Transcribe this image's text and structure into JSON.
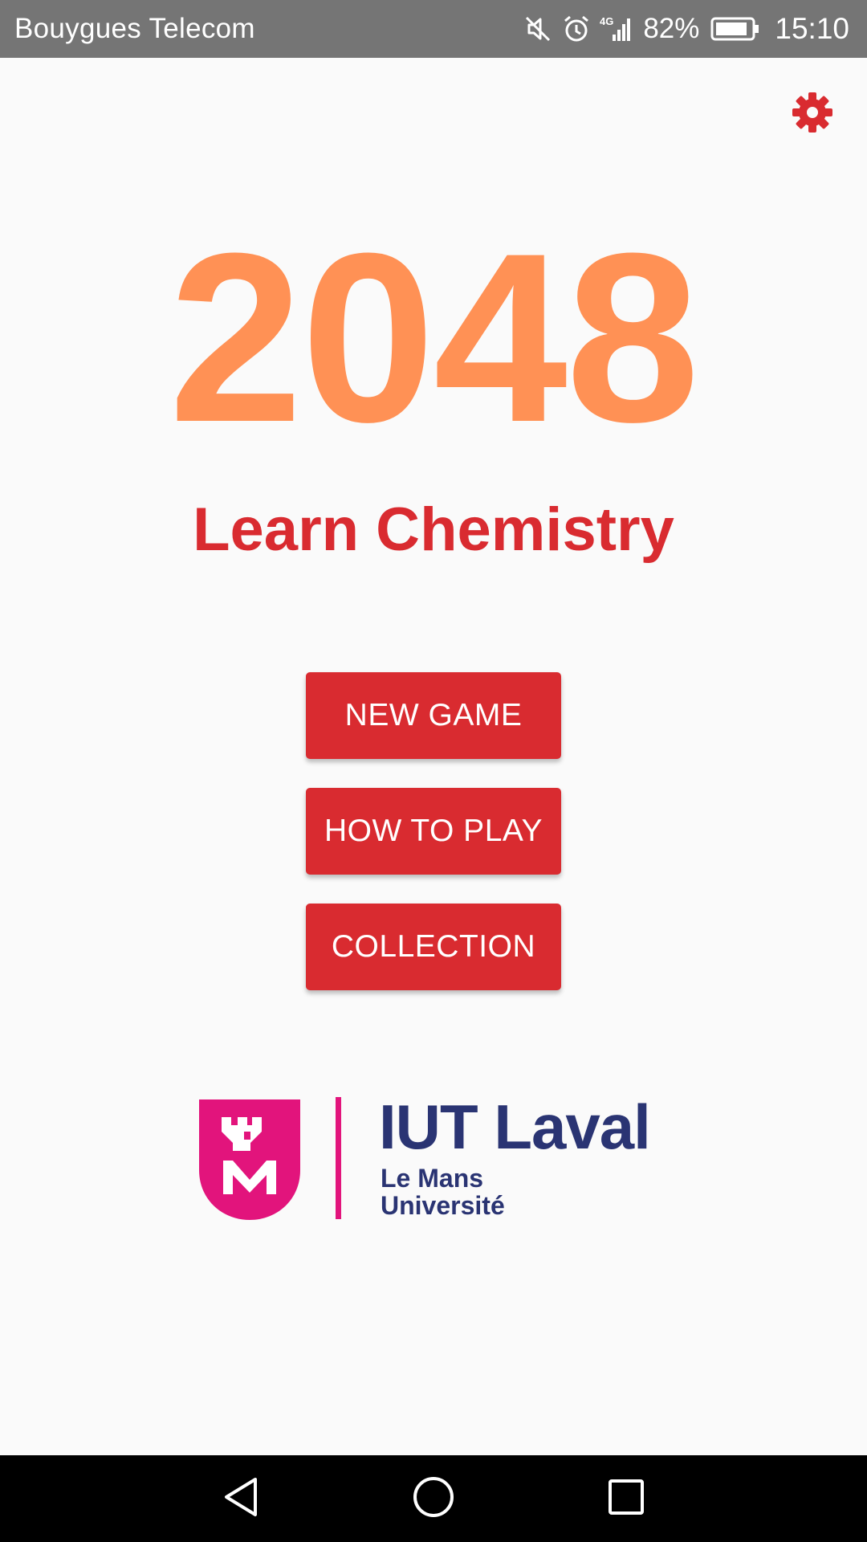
{
  "status_bar": {
    "carrier": "Bouygues Telecom",
    "battery_percent": "82%",
    "time": "15:10",
    "network_label": "4G",
    "icons": [
      "mute-icon",
      "alarm-icon",
      "signal-icon",
      "battery-icon"
    ]
  },
  "header": {
    "settings_icon": "gear-icon"
  },
  "main": {
    "title": "2048",
    "subtitle": "Learn Chemistry",
    "buttons": {
      "new_game": "NEW GAME",
      "how_to_play": "HOW TO PLAY",
      "collection": "COLLECTION"
    }
  },
  "logo": {
    "name": "IUT Laval",
    "line1": "Le Mans",
    "line2": "Université"
  },
  "navigation": {
    "icons": [
      "back-icon",
      "home-icon",
      "recent-apps-icon"
    ]
  },
  "colors": {
    "title": "#FF9155",
    "accent": "#D92B30",
    "logo_magenta": "#E2147C",
    "logo_navy": "#2A3473",
    "status_bar": "#757575",
    "background": "#FAFAFA"
  }
}
